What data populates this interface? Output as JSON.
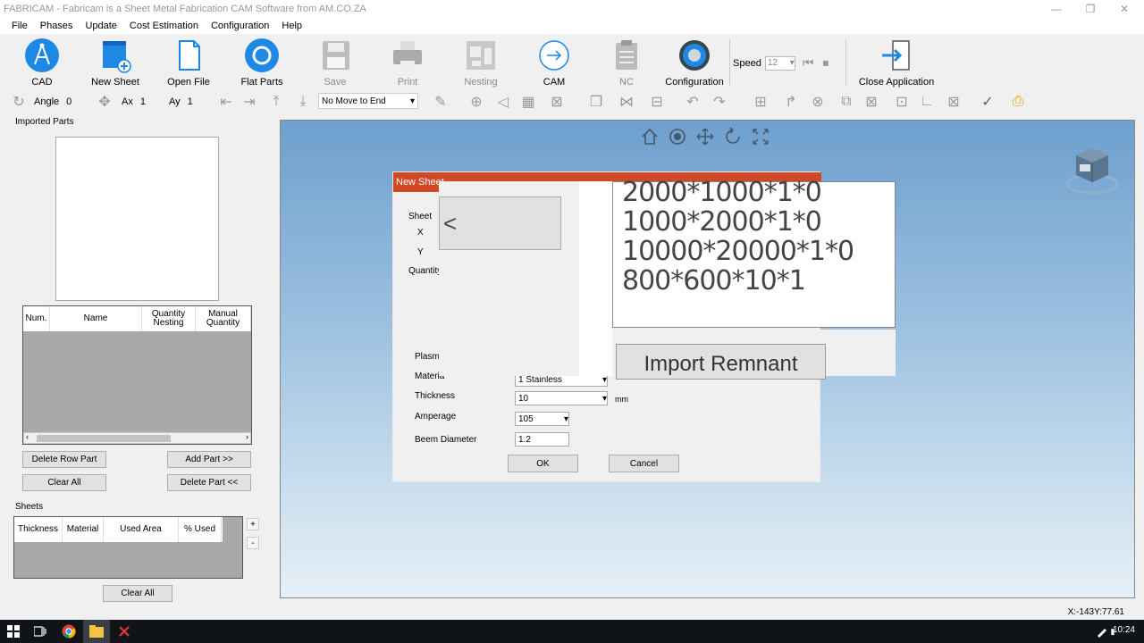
{
  "window": {
    "title": "FABRICAM - Fabricam is a Sheet Metal Fabrication CAM Software from AM.CO.ZA",
    "minimize_glyph": "—",
    "restore_glyph": "❐",
    "close_glyph": "✕"
  },
  "menu": [
    "File",
    "Phases",
    "Update",
    "Cost Estimation",
    "Configuration",
    "Help"
  ],
  "ribbon": {
    "cad": "CAD",
    "new_sheet": "New Sheet",
    "open_file": "Open File",
    "flat_parts": "Flat Parts",
    "save": "Save",
    "print": "Print",
    "nesting": "Nesting",
    "cam": "CAM",
    "nc": "NC",
    "configuration": "Configuration",
    "close_application": "Close Application",
    "speed_label": "Speed",
    "speed_value": "12"
  },
  "toolbar": {
    "angle_label": "Angle",
    "angle_value": "0",
    "ax_label": "Ax",
    "ax_value": "1",
    "ay_label": "Ay",
    "ay_value": "1",
    "move_option": "No Move to End"
  },
  "left_panel": {
    "imported_parts_label": "Imported Parts",
    "parts_table_headers": [
      "Num.",
      "Name",
      "Quantity Nesting",
      "Manual Quantity"
    ],
    "delete_row_part": "Delete Row Part",
    "add_part": "Add Part >>",
    "clear_all": "Clear All",
    "delete_part": "Delete Part <<",
    "sheets_label": "Sheets",
    "sheets_table_headers": [
      "Thickness",
      "Material",
      "Used Area",
      "% Used"
    ],
    "plus": "+",
    "minus": "-",
    "sheets_clear_all": "Clear All"
  },
  "dialog": {
    "title": "New Sheet",
    "labels": {
      "sheet": "Sheet",
      "x": "X",
      "y": "Y",
      "quantity": "Quantity",
      "plasma": "Plasma",
      "material": "Materia",
      "thickness": "Thickness",
      "amperage": "Amperage",
      "beam_diameter": "Beem Diameter"
    },
    "material_value": "1  Stainless",
    "thickness_value": "10",
    "thickness_unit": "mm",
    "amperage_value": "105",
    "beam_diameter_value": "1.2",
    "ok": "OK",
    "cancel": "Cancel"
  },
  "zoom_overlay": {
    "back_arrow": "<",
    "sheet_list": [
      "2000*1000*1*0",
      "1000*2000*1*0",
      "10000*20000*1*0",
      "800*600*10*1"
    ],
    "import_remnant": "Import Remnant"
  },
  "status": {
    "coords": "X:-143Y:77.61"
  },
  "taskbar": {
    "time": "10:24"
  },
  "colors": {
    "dialog_title": "#d24726",
    "viewport_top": "#6e9fce",
    "accent_blue": "#1e88e5"
  }
}
